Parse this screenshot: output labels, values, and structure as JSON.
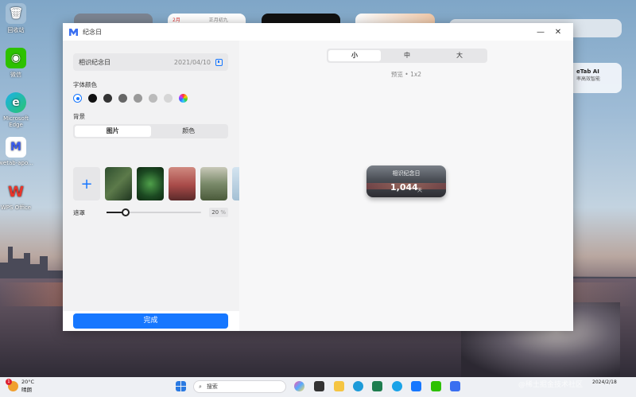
{
  "desktop": {
    "icons": [
      {
        "label": "回收站"
      },
      {
        "label": "微信"
      },
      {
        "label": "Microsoft Edge"
      },
      {
        "label": "wetab-apo..."
      },
      {
        "label": "WPS Office"
      }
    ],
    "widgets": {
      "calendar_month": "2月",
      "calendar_lunar": "正月初九"
    },
    "side_widget": {
      "title": "eTab AI",
      "subtitle": "率高效智能"
    }
  },
  "window": {
    "title": "纪念日",
    "minimize": "—",
    "close": "✕"
  },
  "settings": {
    "name": "相识纪念日",
    "date": "2021/04/10",
    "font_color_label": "字体颜色",
    "colors": [
      "#ffffff",
      "#111111",
      "#333333",
      "#666666",
      "#999999",
      "#bbbbbb",
      "#d6d6d6"
    ],
    "background_label": "背景",
    "bg_tabs": [
      "图片",
      "颜色"
    ],
    "bg_active": "图片",
    "add_symbol": "+",
    "mask_label": "遮罩",
    "mask_value": 20,
    "mask_display": "20",
    "mask_unit": "%",
    "done_label": "完成"
  },
  "preview": {
    "size_tabs": [
      "小",
      "中",
      "大"
    ],
    "size_active": "小",
    "hint": "预览 • 1x2",
    "card_name": "相识纪念日",
    "card_count": "1,044",
    "card_unit": "天"
  },
  "taskbar": {
    "temp": "20°C",
    "weather": "晴朗",
    "badge": "1",
    "search_placeholder": "搜索",
    "time": "",
    "date": "2024/2/18"
  },
  "watermark": "@稀土掘金技术社区"
}
